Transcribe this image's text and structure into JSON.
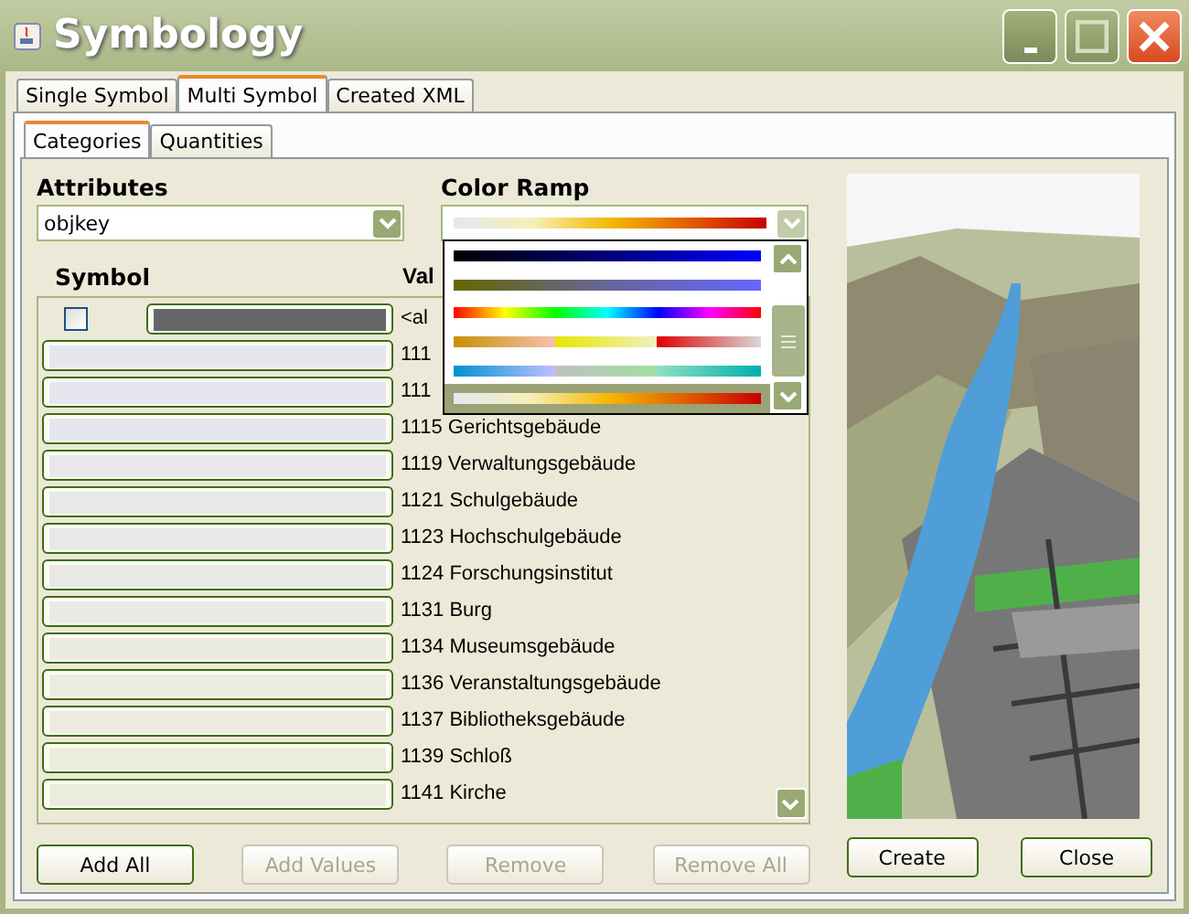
{
  "window": {
    "title": "Symbology"
  },
  "tabs": [
    {
      "label": "Single Symbol",
      "selected": false
    },
    {
      "label": "Multi Symbol",
      "selected": true
    },
    {
      "label": "Created XML",
      "selected": false
    }
  ],
  "subtabs": [
    {
      "label": "Categories",
      "selected": true
    },
    {
      "label": "Quantities",
      "selected": false
    }
  ],
  "attributes": {
    "label": "Attributes",
    "value": "objkey"
  },
  "color_ramp": {
    "label": "Color Ramp",
    "options": [
      {
        "selected": false
      },
      {
        "selected": false
      },
      {
        "selected": false
      },
      {
        "selected": false
      },
      {
        "selected": false
      },
      {
        "selected": true
      }
    ]
  },
  "table": {
    "columns": [
      "Symbol",
      "Val"
    ],
    "rows": [
      {
        "kind": "all",
        "checked": false,
        "color": "#666666",
        "value": "<al"
      },
      {
        "kind": "value",
        "color": "#e6e6ee",
        "value": "111"
      },
      {
        "kind": "value",
        "color": "#e6e6ee",
        "value": "111"
      },
      {
        "kind": "value",
        "color": "#e6e6ee",
        "value": "1115 Gerichtsgebäude"
      },
      {
        "kind": "value",
        "color": "#e8e8ec",
        "value": "1119 Verwaltungsgebäude"
      },
      {
        "kind": "value",
        "color": "#e8e8ea",
        "value": "1121 Schulgebäude"
      },
      {
        "kind": "value",
        "color": "#e8e8e8",
        "value": "1123 Hochschulgebäude"
      },
      {
        "kind": "value",
        "color": "#e8e8e6",
        "value": "1124 Forschungsinstitut"
      },
      {
        "kind": "value",
        "color": "#eaeae4",
        "value": "1131 Burg"
      },
      {
        "kind": "value",
        "color": "#eaeae2",
        "value": "1134 Museumsgebäude"
      },
      {
        "kind": "value",
        "color": "#ebebe0",
        "value": "1136 Veranstaltungsgebäude"
      },
      {
        "kind": "value",
        "color": "#ebebe0",
        "value": "1137 Bibliotheksgebäude"
      },
      {
        "kind": "value",
        "color": "#ececdf",
        "value": "1139 Schloß"
      },
      {
        "kind": "value",
        "color": "#ececdd",
        "value": "1141 Kirche"
      }
    ]
  },
  "buttons": [
    {
      "label": "Add All",
      "disabled": false
    },
    {
      "label": "Add Values",
      "disabled": true
    },
    {
      "label": "Remove",
      "disabled": true
    },
    {
      "label": "Remove All",
      "disabled": true
    }
  ],
  "side_buttons": [
    {
      "label": "Create",
      "disabled": false
    },
    {
      "label": "Close",
      "disabled": false
    }
  ]
}
